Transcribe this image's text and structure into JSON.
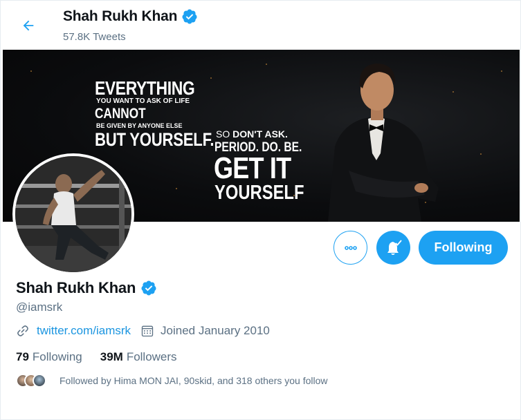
{
  "header": {
    "name": "Shah Rukh Khan",
    "tweet_count": "57.8K Tweets"
  },
  "banner": {
    "line1": "EVERYTHING",
    "line2": "YOU WANT TO ASK OF LIFE",
    "line3": "CANNOT",
    "line4": "BE GIVEN BY ANYONE ELSE",
    "line5": "BUT YOURSELF.",
    "line6_a": "SO ",
    "line6_b": "DON'T ASK.",
    "line7": "PERIOD. DO. BE.",
    "line8": "GET IT",
    "line9": "YOURSELF"
  },
  "actions": {
    "following_label": "Following"
  },
  "profile": {
    "name": "Shah Rukh Khan",
    "handle": "@iamsrk",
    "website": "twitter.com/iamsrk",
    "joined": "Joined January 2010",
    "following_count": "79",
    "following_label": "Following",
    "followers_count": "39M",
    "followers_label": "Followers",
    "followed_by": "Followed by Hima MON JAI, 90skid, and 318 others you follow"
  },
  "colors": {
    "accent": "#1da1f2",
    "link": "#1b95e0",
    "muted": "#5b7083",
    "text": "#0f1419"
  },
  "icons": {
    "back": "arrow-left-icon",
    "verified": "verified-badge-icon",
    "more": "more-horizontal-icon",
    "notifications": "bell-check-icon",
    "link": "link-icon",
    "calendar": "calendar-icon"
  }
}
